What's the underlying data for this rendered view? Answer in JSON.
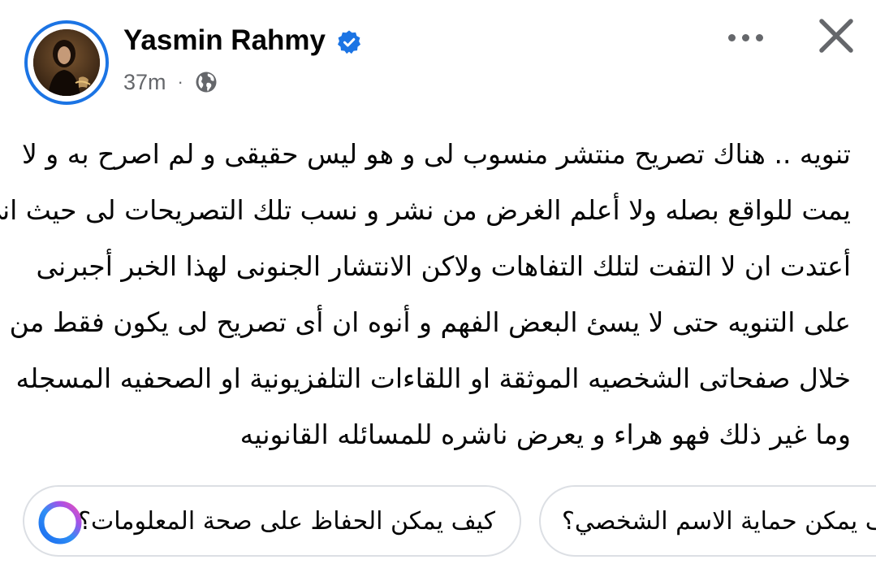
{
  "post": {
    "author_name": "Yasmin Rahmy",
    "timestamp": "37m",
    "separator": "·",
    "audience_icon": "globe-icon",
    "verified_icon": "verified-badge-icon",
    "text_lines": [
      "تنويه .. هناك تصريح منتشر منسوب لى و هو ليس حقيقى و لم اصرح به و لا",
      "يمت للواقع بصله ولا أعلم الغرض من نشر و نسب تلك التصريحات لى حيث انى",
      "أعتدت ان لا التفت لتلك التفاهات ولاكن الانتشار الجنونى لهذا الخبر أجبرنى",
      "على التنويه حتى لا يسئ البعض الفهم و أنوه ان أى تصريح لى يكون فقط من",
      "خلال صفحاتى الشخصيه الموثقة او اللقاءات التلفزيونية او الصحفيه المسجله",
      "وما غير ذلك فهو هراء و يعرض ناشره للمسائله القانونيه"
    ]
  },
  "header_actions": {
    "more_icon": "more-options-icon",
    "close_icon": "close-icon"
  },
  "suggestions": [
    {
      "label": "كيف يمكن الحفاظ على صحة المعلومات؟",
      "icon": "meta-ai-icon"
    },
    {
      "label": "كيف يمكن حماية الاسم الشخصي؟"
    }
  ],
  "colors": {
    "accent": "#1b74e4",
    "text_primary": "#050505",
    "text_secondary": "#65676b",
    "chip_border": "#dcdfe4"
  }
}
